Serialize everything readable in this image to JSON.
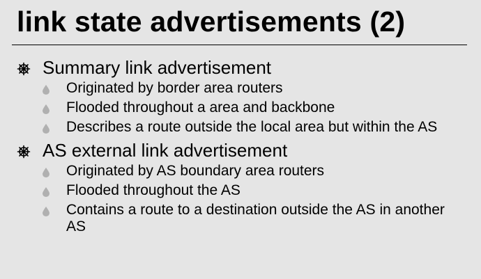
{
  "slide": {
    "title": "link state advertisements (2)",
    "sections": [
      {
        "heading": "Summary link advertisement",
        "items": [
          "Originated by border area routers",
          "Flooded throughout a area and backbone",
          "Describes a route outside the local area but within the AS"
        ]
      },
      {
        "heading": "AS external link advertisement",
        "items": [
          "Originated by AS boundary area routers",
          "Flooded throughout the AS",
          "Contains a route to a destination outside the AS in another AS"
        ]
      }
    ],
    "icons": {
      "level1": "wheel-bullet-icon",
      "level2": "drop-bullet-icon"
    },
    "colors": {
      "background": "#e5e5e5",
      "text": "#000000",
      "drop_bullet": "#b0b0b0"
    }
  }
}
